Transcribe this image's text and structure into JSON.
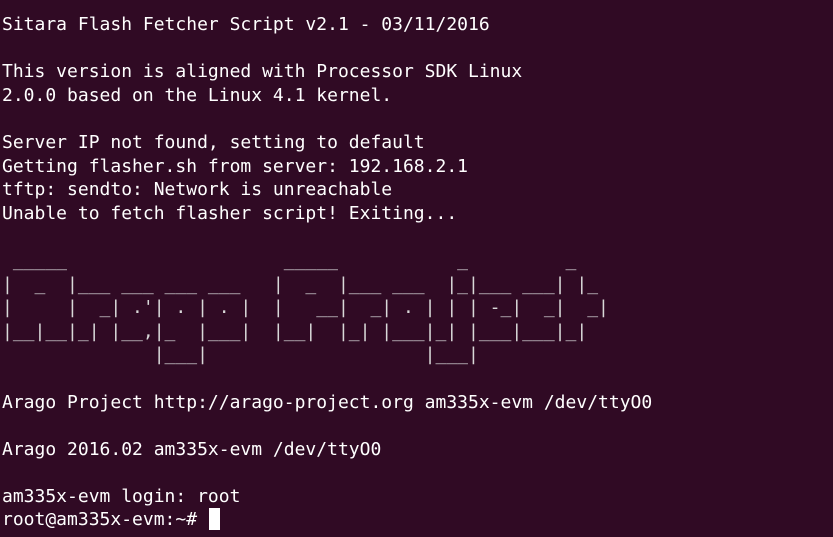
{
  "terminal": {
    "background": "#300a24",
    "foreground": "#ffffff",
    "header": {
      "title": "Sitara Flash Fetcher Script v2.1 - 03/11/2016",
      "aligned_1": "This version is aligned with Processor SDK Linux",
      "aligned_2": "2.0.0 based on the Linux 4.1 kernel."
    },
    "messages": {
      "server_ip": "Server IP not found, setting to default",
      "getting": "Getting flasher.sh from server: 192.168.2.1",
      "tftp": "tftp: sendto: Network is unreachable",
      "unable": "Unable to fetch flasher script! Exiting..."
    },
    "ascii_art": [
      " _____                    _____           _         _   ",
      "|  _  |___ ___ ___ ___   |  _  |___ ___  |_|___ ___| |_ ",
      "|     |  _| .'| . | . |  |   __|  _| . | | | -_|  _|  _|",
      "|__|__|_| |__,|_  |___|  |__|  |_| |___|_| |___|___|_|  ",
      "              |___|                    |___|            "
    ],
    "footer": {
      "project_line": "Arago Project http://arago-project.org am335x-evm /dev/ttyO0",
      "version_line": "Arago 2016.02 am335x-evm /dev/ttyO0",
      "login_line": "am335x-evm login: root",
      "prompt": "root@am335x-evm:~# "
    }
  }
}
